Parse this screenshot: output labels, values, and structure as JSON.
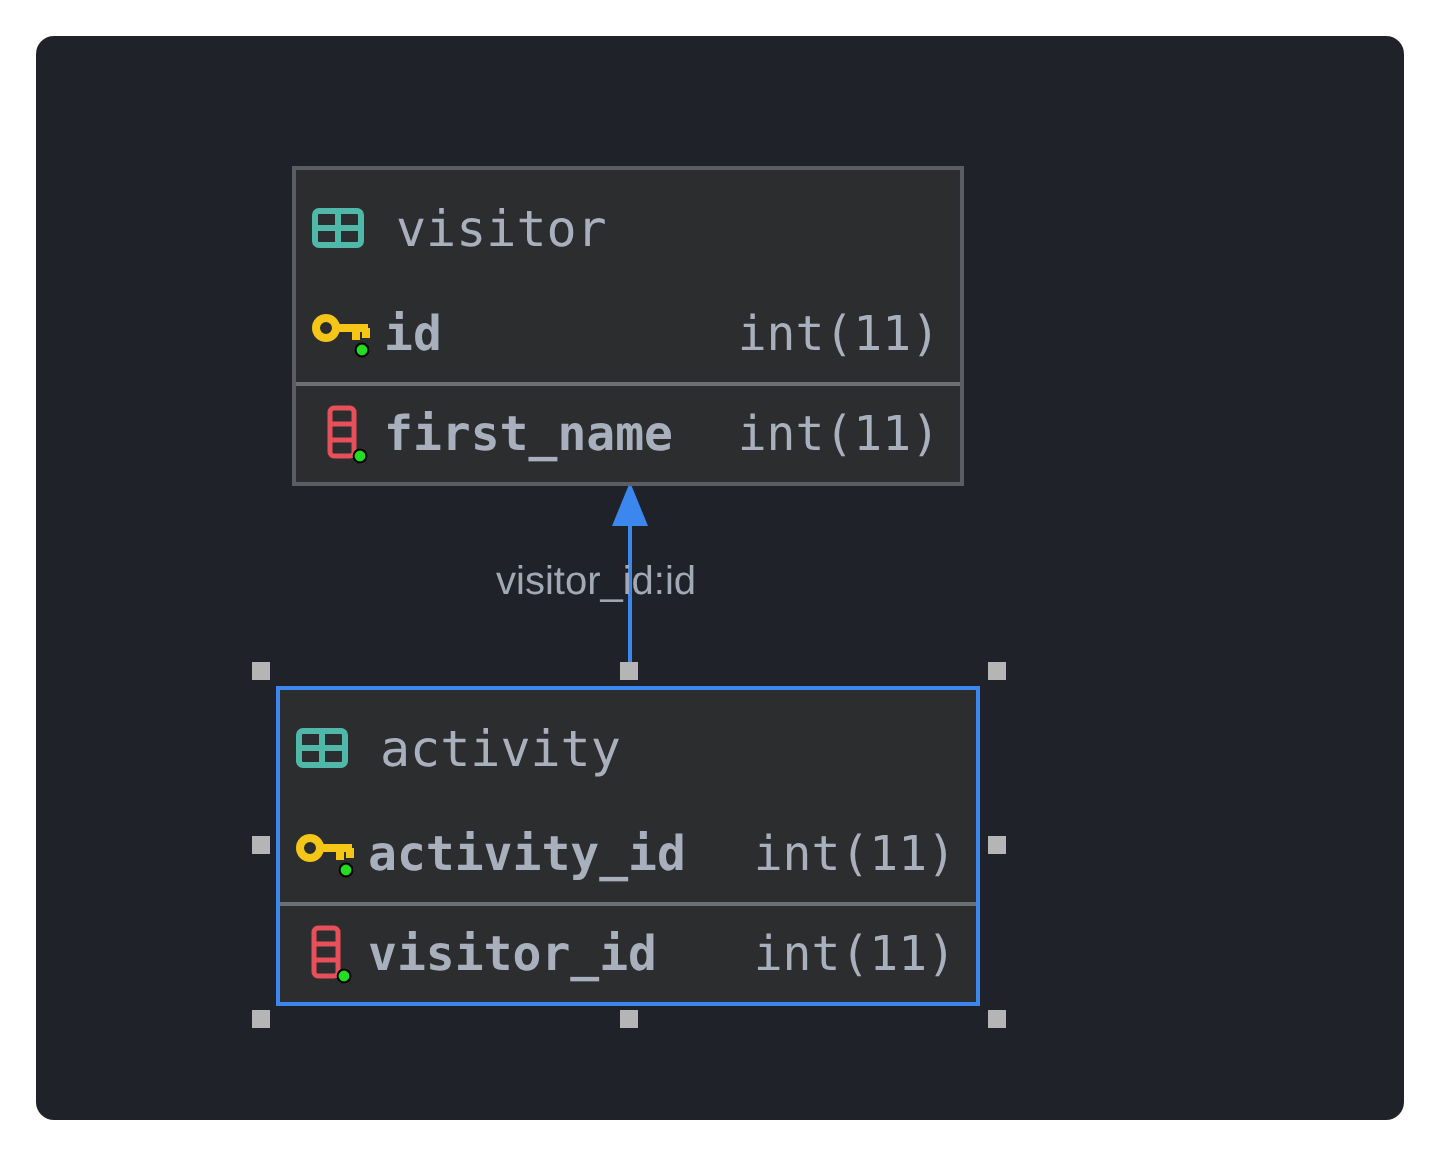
{
  "tables": [
    {
      "name": "visitor",
      "selected": false,
      "columns": [
        {
          "kind": "primary_key",
          "name": "id",
          "type": "int(11)"
        },
        {
          "kind": "column",
          "name": "first_name",
          "type": "int(11)"
        }
      ]
    },
    {
      "name": "activity",
      "selected": true,
      "columns": [
        {
          "kind": "primary_key",
          "name": "activity_id",
          "type": "int(11)"
        },
        {
          "kind": "column",
          "name": "visitor_id",
          "type": "int(11)"
        }
      ]
    }
  ],
  "relationship": {
    "label": "visitor_id:id"
  }
}
